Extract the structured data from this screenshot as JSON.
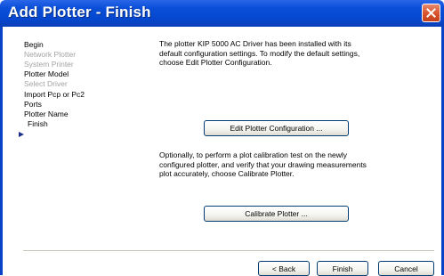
{
  "window": {
    "title": "Add Plotter - Finish",
    "close_icon": "close-icon"
  },
  "steps": [
    {
      "label": "Begin",
      "enabled": true
    },
    {
      "label": "Network Plotter",
      "enabled": false
    },
    {
      "label": "System Printer",
      "enabled": false
    },
    {
      "label": "Plotter Model",
      "enabled": true
    },
    {
      "label": "Select Driver",
      "enabled": false
    },
    {
      "label": "Import Pcp or Pc2",
      "enabled": true
    },
    {
      "label": "Ports",
      "enabled": true
    },
    {
      "label": "Plotter Name",
      "enabled": true
    },
    {
      "label": "Finish",
      "enabled": true,
      "current": true
    }
  ],
  "content": {
    "intro_line1": "The plotter KIP 5000 AC Driver has been installed with its",
    "intro_line2": "default configuration settings.  To modify the default settings,",
    "intro_line3": "choose Edit Plotter Configuration.",
    "edit_button": "Edit Plotter Configuration ...",
    "calib_line1": "Optionally, to perform a plot calibration test on the newly",
    "calib_line2": "configured plotter, and verify that your drawing measurements",
    "calib_line3": "plot accurately, choose Calibrate Plotter.",
    "calibrate_button": "Calibrate Plotter ..."
  },
  "footer": {
    "back_button": "< Back",
    "finish_button": "Finish",
    "cancel_button": "Cancel"
  },
  "colors": {
    "title_bar": "#0548cf",
    "close_button": "#d9562f",
    "disabled_text": "#a3a3a3",
    "button_border": "#003c74"
  }
}
